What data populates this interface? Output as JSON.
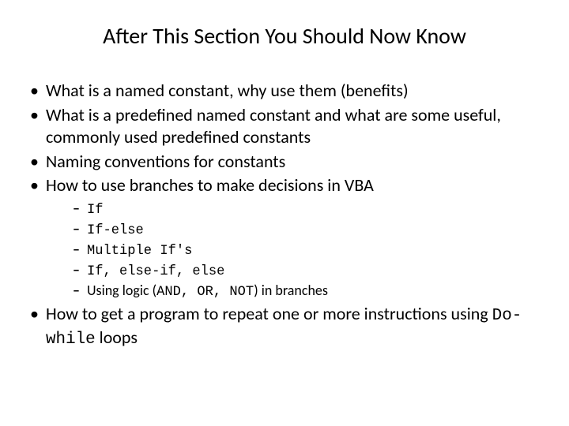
{
  "title": "After This Section You Should Now Know",
  "bullets": {
    "b1": "What is a named constant, why use them (benefits)",
    "b2": "What is a predefined named constant and what are some useful, commonly used predefined constants",
    "b3": "Naming conventions for constants",
    "b4": "How to use branches to make decisions in VBA",
    "b5_pre": "How to get a program to repeat one or more instructions using ",
    "b5_code": "Do-while",
    "b5_post": " loops"
  },
  "sub": {
    "s1": "If",
    "s2": "If-else",
    "s3": "Multiple If's",
    "s4": "If, else-if, else",
    "s5_pre": "Using logic (",
    "s5_code": "AND, OR, NOT",
    "s5_post": ") in branches"
  }
}
